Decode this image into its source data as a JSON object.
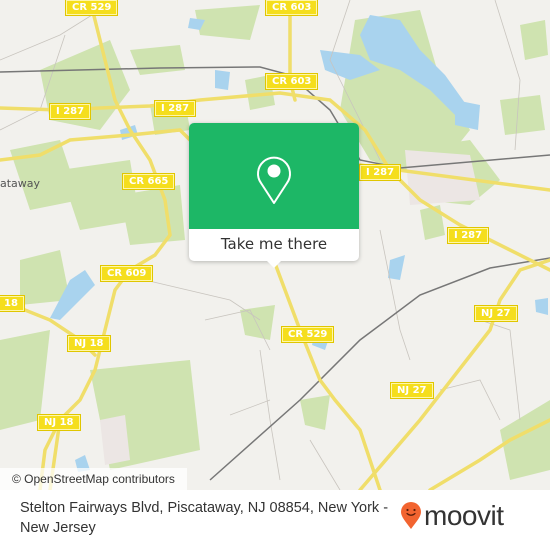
{
  "map": {
    "route_shields": [
      {
        "id": "cr529-top",
        "label": "CR 529"
      },
      {
        "id": "cr603-top",
        "label": "CR 603"
      },
      {
        "id": "cr603-mid",
        "label": "CR 603"
      },
      {
        "id": "i287-left",
        "label": "I 287"
      },
      {
        "id": "i287-center",
        "label": "I 287"
      },
      {
        "id": "i287-right",
        "label": "I 287"
      },
      {
        "id": "i287-far-right",
        "label": "I 287"
      },
      {
        "id": "cr665",
        "label": "CR 665"
      },
      {
        "id": "cr609",
        "label": "CR 609"
      },
      {
        "id": "nj18-edge",
        "label": "18"
      },
      {
        "id": "nj18-mid",
        "label": "NJ 18"
      },
      {
        "id": "nj18-bottom",
        "label": "NJ 18"
      },
      {
        "id": "cr529-bottom",
        "label": "CR 529"
      },
      {
        "id": "nj27-right",
        "label": "NJ 27"
      },
      {
        "id": "nj27-bottom",
        "label": "NJ 27"
      }
    ],
    "place_labels": [
      {
        "id": "piscataway",
        "label": "ataway"
      }
    ],
    "attribution": "© OpenStreetMap contributors"
  },
  "popup": {
    "icon": "map-pin-icon",
    "button_label": "Take me there",
    "color": "#1db766"
  },
  "footer": {
    "address": "Stelton Fairways Blvd, Piscataway, NJ 08854, New York - New Jersey",
    "brand": "moovit",
    "brand_color": "#f26430"
  }
}
